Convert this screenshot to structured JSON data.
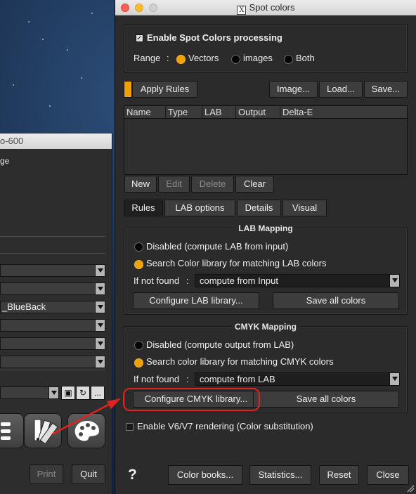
{
  "window": {
    "title": "Spot colors"
  },
  "enable_group": {
    "enable_label": "Enable Spot Colors processing",
    "enabled": true,
    "range_label": "Range",
    "range_sep": ":",
    "range_options": [
      "Vectors",
      "images",
      "Both"
    ],
    "range_selected": "Vectors"
  },
  "toolbar": {
    "apply_rules": "Apply Rules",
    "image": "Image...",
    "load": "Load...",
    "save": "Save..."
  },
  "rules_table": {
    "columns": [
      "Name",
      "Type",
      "LAB",
      "Output",
      "Delta-E"
    ],
    "rows": []
  },
  "table_actions": {
    "new": "New",
    "edit": "Edit",
    "delete": "Delete",
    "clear": "Clear"
  },
  "tabs": [
    "Rules",
    "LAB options",
    "Details",
    "Visual"
  ],
  "active_tab": "Rules",
  "lab_mapping": {
    "title": "LAB Mapping",
    "option_disabled": "Disabled (compute LAB from input)",
    "option_search": "Search Color library for matching LAB colors",
    "selected": "search",
    "if_not_found_label": "If not found",
    "sep": ":",
    "if_not_found_value": "compute from Input",
    "configure_button": "Configure LAB library...",
    "save_all_button": "Save all colors"
  },
  "cmyk_mapping": {
    "title": "CMYK Mapping",
    "option_disabled": "Disabled (compute output from LAB)",
    "option_search": "Search color library for matching CMYK colors",
    "selected": "search",
    "if_not_found_label": "If not found",
    "sep": ":",
    "if_not_found_value": "compute from LAB",
    "configure_button": "Configure CMYK library...",
    "save_all_button": "Save all colors"
  },
  "v6v7": {
    "label": "Enable V6/V7 rendering (Color substitution)",
    "checked": false
  },
  "footer": {
    "help": "?",
    "color_books": "Color books...",
    "statistics": "Statistics...",
    "reset": "Reset",
    "close": "Close"
  },
  "background_window": {
    "title_fragment": "o-600",
    "label_fragment": "ge",
    "select_value": "_BlueBack",
    "more_button": "...",
    "print_button": "Print",
    "quit_button": "Quit"
  },
  "colors": {
    "accent_orange": "#f0a000",
    "callout_red": "#e0231f",
    "panel_bg": "#2b2b2b"
  }
}
